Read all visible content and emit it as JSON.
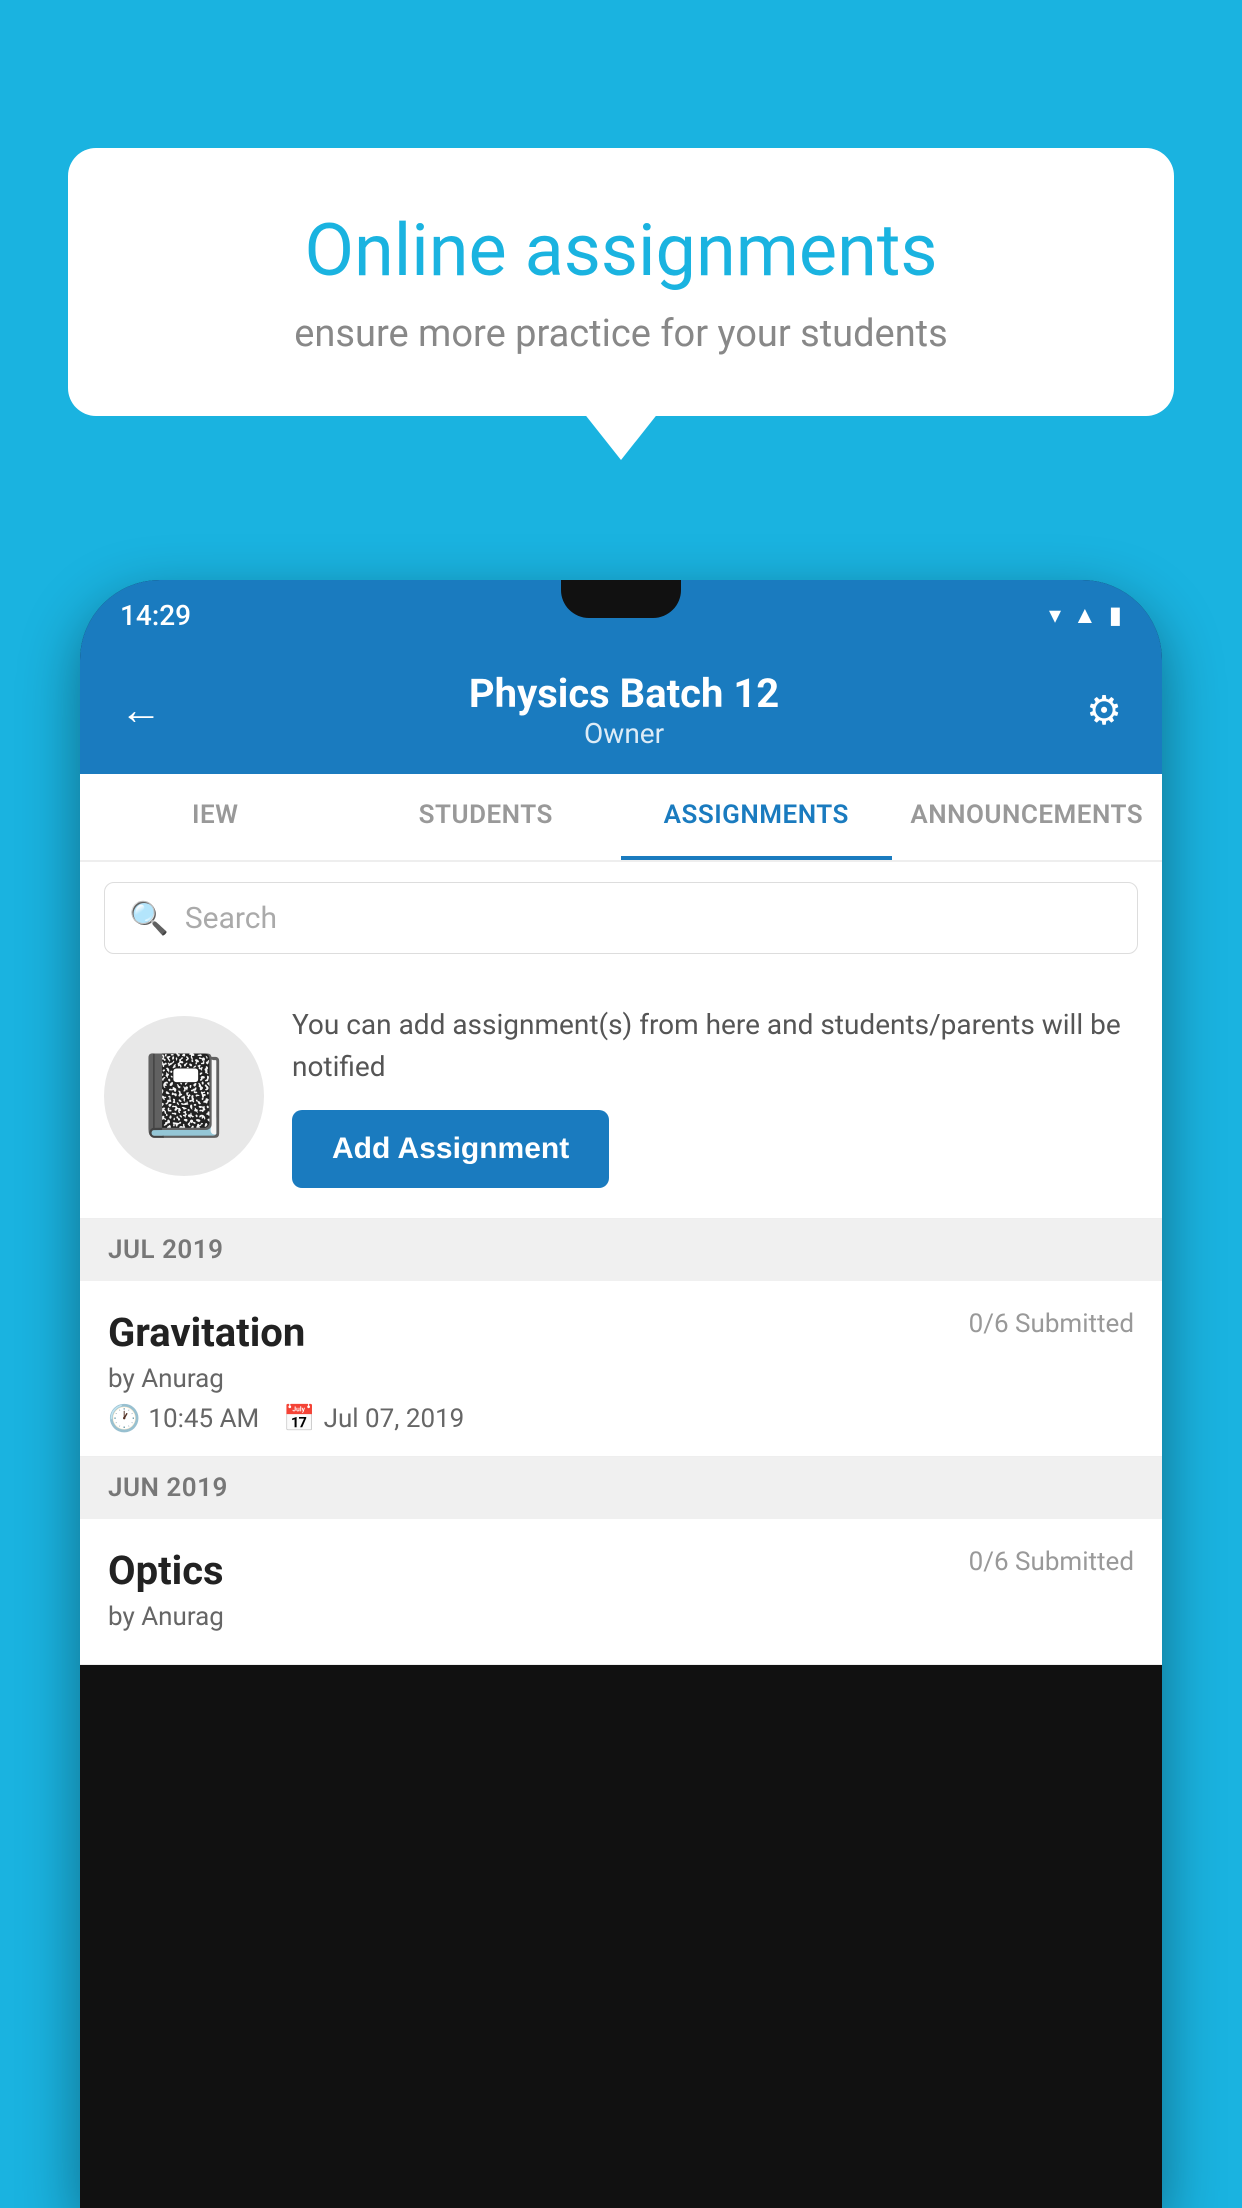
{
  "background_color": "#1ab3e0",
  "speech_bubble": {
    "title": "Online assignments",
    "subtitle": "ensure more practice for your students"
  },
  "status_bar": {
    "time": "14:29",
    "icons": [
      "wifi",
      "signal",
      "battery"
    ]
  },
  "header": {
    "title": "Physics Batch 12",
    "subtitle": "Owner",
    "back_label": "←",
    "settings_label": "⚙"
  },
  "tabs": [
    {
      "label": "IEW",
      "active": false
    },
    {
      "label": "STUDENTS",
      "active": false
    },
    {
      "label": "ASSIGNMENTS",
      "active": true
    },
    {
      "label": "ANNOUNCEMENTS",
      "active": false
    }
  ],
  "search": {
    "placeholder": "Search"
  },
  "add_assignment_card": {
    "description": "You can add assignment(s) from here and students/parents will be notified",
    "button_label": "Add Assignment"
  },
  "month_sections": [
    {
      "month_label": "JUL 2019",
      "assignments": [
        {
          "name": "Gravitation",
          "submitted": "0/6 Submitted",
          "by": "by Anurag",
          "time": "10:45 AM",
          "date": "Jul 07, 2019"
        }
      ]
    },
    {
      "month_label": "JUN 2019",
      "assignments": [
        {
          "name": "Optics",
          "submitted": "0/6 Submitted",
          "by": "by Anurag",
          "time": "",
          "date": ""
        }
      ]
    }
  ]
}
